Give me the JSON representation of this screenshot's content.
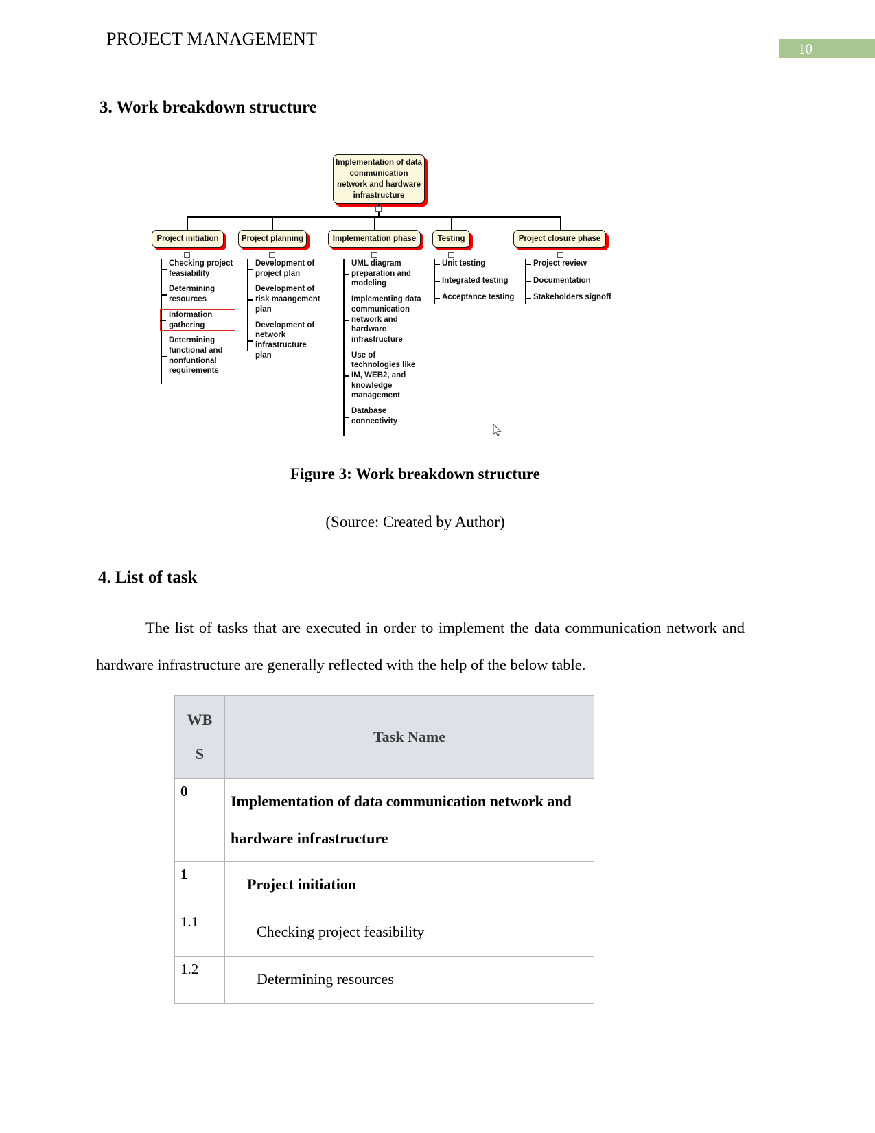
{
  "header": {
    "title": "PROJECT MANAGEMENT",
    "page_number": "10",
    "badge_color": "#a8c68f"
  },
  "sections": {
    "wbs_heading": "3. Work breakdown structure",
    "figure_caption": "Figure 3: Work breakdown structure",
    "figure_source": "(Source: Created by Author)",
    "tasks_heading": "4. List of task",
    "tasks_paragraph": "The list of tasks that are executed in order to implement the data communication network and hardware infrastructure are generally reflected with the help of the below table."
  },
  "diagram": {
    "root": "Implementation of data communication network and hardware infrastructure",
    "node_fill": "#fcf8dd",
    "node_shadow": "#f20000",
    "highlight_color": "#d93025",
    "branches": [
      {
        "title": "Project initiation",
        "leaves": [
          {
            "text": "Checking project feasiability",
            "highlighted": false
          },
          {
            "text": "Determining resources",
            "highlighted": false
          },
          {
            "text": "Information gathering",
            "highlighted": true
          },
          {
            "text": "Determining functional and nonfuntional requirements",
            "highlighted": false
          }
        ]
      },
      {
        "title": "Project planning",
        "leaves": [
          {
            "text": "Development of project plan",
            "highlighted": false
          },
          {
            "text": "Development of risk maangement plan",
            "highlighted": false
          },
          {
            "text": "Development of network infrastructure plan",
            "highlighted": false
          }
        ]
      },
      {
        "title": "Implementation phase",
        "leaves": [
          {
            "text": "UML diagram preparation and modeling",
            "highlighted": false
          },
          {
            "text": "Implementing data communication network and hardware infrastructure",
            "highlighted": false
          },
          {
            "text": "Use of technologies like IM, WEB2, and knowledge management",
            "highlighted": false
          },
          {
            "text": "Database connectivity",
            "highlighted": false
          }
        ]
      },
      {
        "title": "Testing",
        "leaves": [
          {
            "text": "Unit testing",
            "highlighted": false
          },
          {
            "text": "Integrated testing",
            "highlighted": false
          },
          {
            "text": "Acceptance testing",
            "highlighted": false
          }
        ]
      },
      {
        "title": "Project closure phase",
        "leaves": [
          {
            "text": "Project review",
            "highlighted": false
          },
          {
            "text": "Documentation",
            "highlighted": false
          },
          {
            "text": "Stakeholders signoff",
            "highlighted": false
          }
        ]
      }
    ]
  },
  "table": {
    "header_bg": "#dde2e9",
    "columns": [
      "WB\nS",
      "Task Name"
    ],
    "col_wbs_line1": "WB",
    "col_wbs_line2": "S",
    "col_task": "Task Name",
    "rows": [
      {
        "wbs": "0",
        "task": "Implementation of data communication network and hardware infrastructure",
        "bold": true,
        "indent": 0
      },
      {
        "wbs": "1",
        "task": "Project initiation",
        "bold": true,
        "indent": 1
      },
      {
        "wbs": "1.1",
        "task": "Checking project feasibility",
        "bold": false,
        "indent": 2
      },
      {
        "wbs": "1.2",
        "task": "Determining resources",
        "bold": false,
        "indent": 2
      }
    ]
  }
}
